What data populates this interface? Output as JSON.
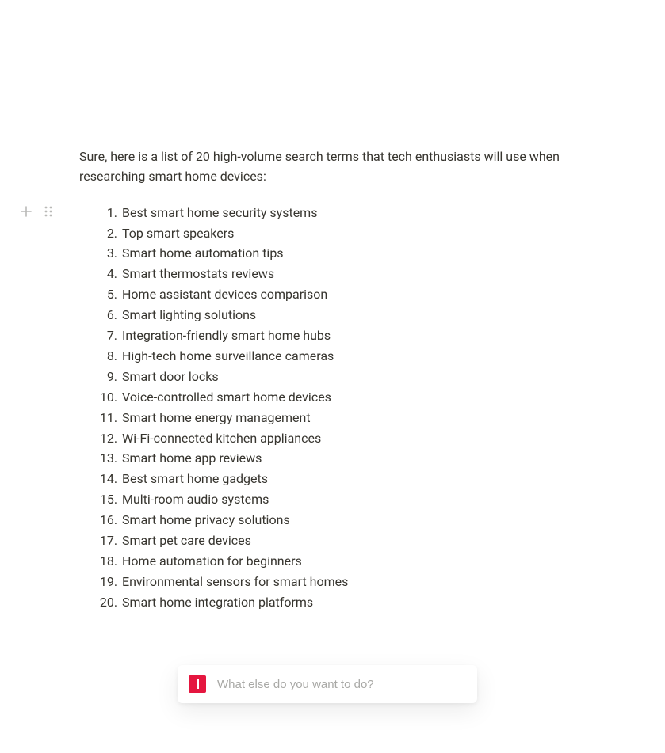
{
  "content": {
    "intro": "Sure, here is a list of 20 high-volume search terms that tech enthusiasts will use when researching smart home devices:",
    "list": [
      "Best smart home security systems",
      "Top smart speakers",
      "Smart home automation tips",
      "Smart thermostats reviews",
      "Home assistant devices comparison",
      "Smart lighting solutions",
      "Integration-friendly smart home hubs",
      "High-tech home surveillance cameras",
      "Smart door locks",
      "Voice-controlled smart home devices",
      "Smart home energy management",
      "Wi-Fi-connected kitchen appliances",
      "Smart home app reviews",
      "Best smart home gadgets",
      "Multi-room audio systems",
      "Smart home privacy solutions",
      "Smart pet care devices",
      "Home automation for beginners",
      "Environmental sensors for smart homes",
      "Smart home integration platforms"
    ]
  },
  "icons": {
    "plus": "plus-icon",
    "drag": "drag-handle-icon",
    "brand": "brand-logo-icon"
  },
  "prompt": {
    "placeholder": "What else do you want to do?",
    "value": ""
  }
}
